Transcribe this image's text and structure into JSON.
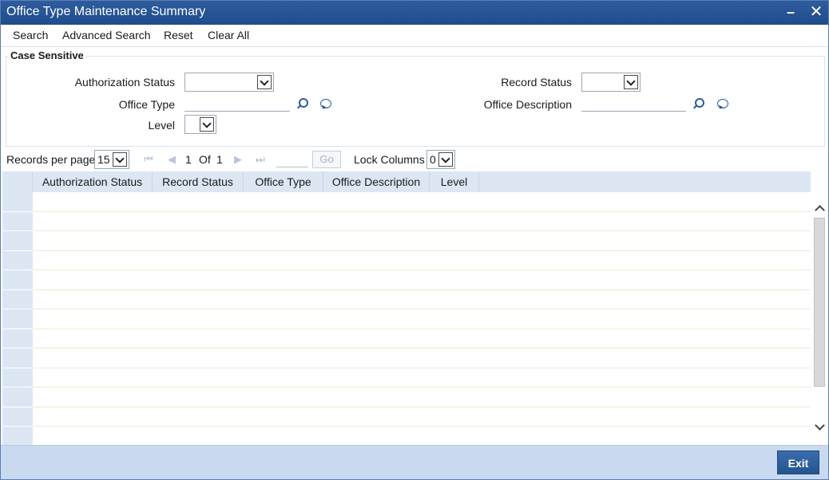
{
  "window": {
    "title": "Office Type Maintenance Summary",
    "minimize_glyph": "–",
    "close_glyph": "✕"
  },
  "toolbar": {
    "search": "Search",
    "advanced_search": "Advanced Search",
    "reset": "Reset",
    "clear_all": "Clear All"
  },
  "criteria": {
    "legend": "Case Sensitive",
    "authorization_status_label": "Authorization Status",
    "authorization_status_value": "",
    "record_status_label": "Record Status",
    "record_status_value": "",
    "office_type_label": "Office Type",
    "office_type_value": "",
    "office_description_label": "Office Description",
    "office_description_value": "",
    "level_label": "Level",
    "level_value": ""
  },
  "pager": {
    "records_per_page_label": "Records per page",
    "records_per_page_value": "15",
    "current_page": "1",
    "of_label": "Of",
    "total_pages": "1",
    "go_label": "Go",
    "lock_columns_label": "Lock Columns",
    "lock_columns_value": "0"
  },
  "grid": {
    "columns": [
      "Authorization Status",
      "Record Status",
      "Office Type",
      "Office Description",
      "Level"
    ],
    "rows": []
  },
  "footer": {
    "exit": "Exit"
  },
  "colors": {
    "titlebar": "#2e5c9e",
    "header_bg": "#dce7f3",
    "footer_bg": "#c9daf0",
    "accent": "#2a5b9c"
  }
}
